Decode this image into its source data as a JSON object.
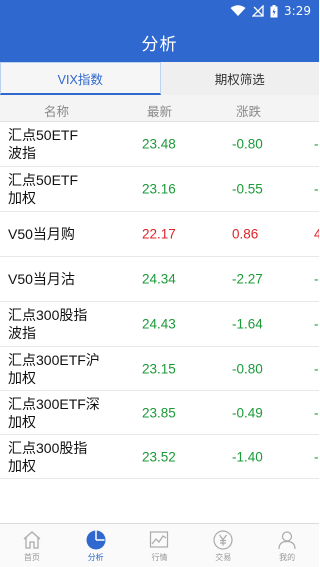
{
  "status": {
    "time": "3:29",
    "wifi_icon": "wifi-icon",
    "signal_icon": "no-signal-icon",
    "battery_icon": "battery-icon"
  },
  "header": {
    "title": "分析"
  },
  "tabs": [
    {
      "label": "VIX指数",
      "active": true
    },
    {
      "label": "期权筛选",
      "active": false
    }
  ],
  "columns": {
    "name": "名称",
    "price": "最新",
    "change": "涨跌"
  },
  "rows": [
    {
      "name_line1": "汇点50ETF",
      "name_line2": "波指",
      "price": "23.48",
      "change": "-0.80",
      "extra": "-",
      "dir": "down"
    },
    {
      "name_line1": "汇点50ETF",
      "name_line2": "加权",
      "price": "23.16",
      "change": "-0.55",
      "extra": "-",
      "dir": "down"
    },
    {
      "name_line1": "V50当月购",
      "name_line2": "",
      "price": "22.17",
      "change": "0.86",
      "extra": "4",
      "dir": "up"
    },
    {
      "name_line1": "V50当月沽",
      "name_line2": "",
      "price": "24.34",
      "change": "-2.27",
      "extra": "-",
      "dir": "down"
    },
    {
      "name_line1": "汇点300股指",
      "name_line2": "波指",
      "price": "24.43",
      "change": "-1.64",
      "extra": "-",
      "dir": "down"
    },
    {
      "name_line1": "汇点300ETF沪",
      "name_line2": "加权",
      "price": "23.15",
      "change": "-0.80",
      "extra": "-",
      "dir": "down"
    },
    {
      "name_line1": "汇点300ETF深",
      "name_line2": "加权",
      "price": "23.85",
      "change": "-0.49",
      "extra": "-",
      "dir": "down"
    },
    {
      "name_line1": "汇点300股指",
      "name_line2": "加权",
      "price": "23.52",
      "change": "-1.40",
      "extra": "-",
      "dir": "down"
    }
  ],
  "nav": [
    {
      "label": "首页",
      "icon": "home-icon",
      "active": false
    },
    {
      "label": "分析",
      "icon": "pie-chart-icon",
      "active": true
    },
    {
      "label": "行情",
      "icon": "trend-chart-icon",
      "active": false
    },
    {
      "label": "交易",
      "icon": "yen-icon",
      "active": false
    },
    {
      "label": "我的",
      "icon": "user-icon",
      "active": false
    }
  ],
  "colors": {
    "brand": "#2f68cf",
    "up": "#e0232a",
    "down": "#1b9a38"
  }
}
